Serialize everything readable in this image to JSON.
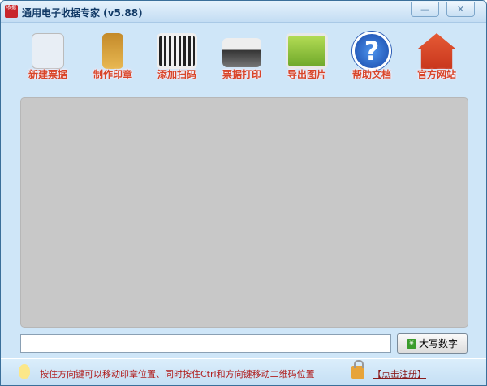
{
  "window": {
    "title": "通用电子收据专家 (v5.88)",
    "app_icon_text": "收据",
    "minimize": "—",
    "close": "✕"
  },
  "toolbar": [
    {
      "id": "new-receipt",
      "label": "新建票据",
      "color": "#e8eef5"
    },
    {
      "id": "make-seal",
      "label": "制作印章",
      "color": "#d9a23b"
    },
    {
      "id": "add-qrcode",
      "label": "添加扫码",
      "color": "#f2f2f2"
    },
    {
      "id": "print-receipt",
      "label": "票据打印",
      "color": "#555555"
    },
    {
      "id": "export-image",
      "label": "导出图片",
      "color": "#8cc43c"
    },
    {
      "id": "help-docs",
      "label": "帮助文档",
      "color": "#1f63c8"
    },
    {
      "id": "official-site",
      "label": "官方网站",
      "color": "#e04d2c"
    }
  ],
  "amount_input": {
    "value": ""
  },
  "uppercase_button": {
    "icon": "¥",
    "label": "大写数字"
  },
  "status": {
    "hint": "按住方向键可以移动印章位置、同时按住Ctrl和方向键移动二维码位置",
    "register": "【点击注册】"
  }
}
